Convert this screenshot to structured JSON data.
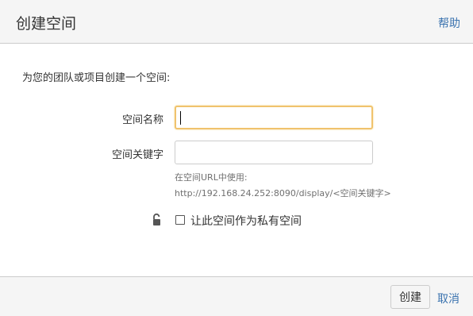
{
  "dialog": {
    "title": "创建空间",
    "help_label": "帮助"
  },
  "form": {
    "intro": "为您的团队或项目创建一个空间:",
    "space_name_label": "空间名称",
    "space_name_value": "",
    "space_key_label": "空间关键字",
    "space_key_value": "",
    "hint_line1": "在空间URL中使用:",
    "hint_line2": "http://192.168.24.252:8090/display/<空间关键字>",
    "private_label": "让此空间作为私有空间",
    "private_checked": false
  },
  "footer": {
    "create_label": "创建",
    "cancel_label": "取消"
  },
  "icons": {
    "lock": "unlock-icon"
  },
  "colors": {
    "link": "#3b73af",
    "focus_border": "#f0c36d",
    "header_bg": "#f5f5f5"
  }
}
